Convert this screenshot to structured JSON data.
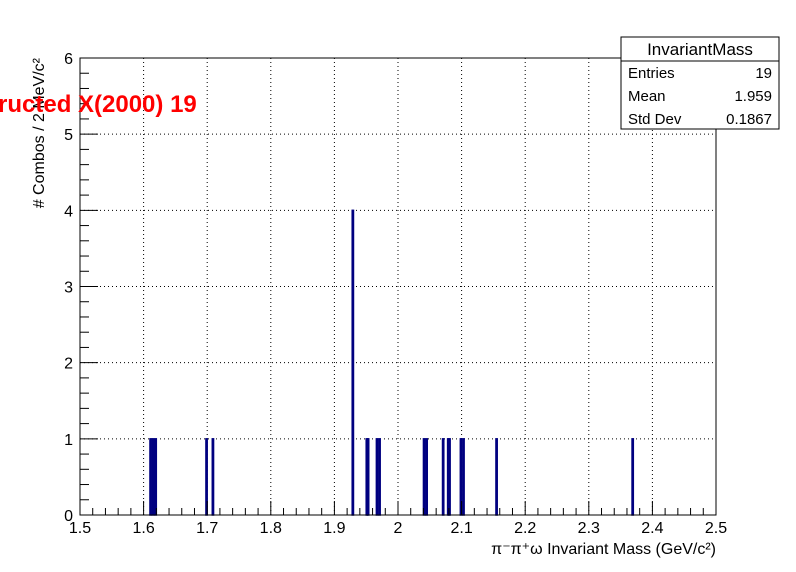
{
  "overlay_title": "ructed X(2000) 19",
  "stats_box": {
    "title": "InvariantMass",
    "rows": [
      {
        "label": "Entries",
        "value": "19"
      },
      {
        "label": "Mean",
        "value": "1.959"
      },
      {
        "label": "Std Dev",
        "value": "0.1867"
      }
    ]
  },
  "chart_data": {
    "type": "bar",
    "xlabel": "π⁻π⁺ω Invariant Mass (GeV/c²)",
    "ylabel": "# Combos / 2 MeV/c²",
    "xlim": [
      1.5,
      2.5
    ],
    "ylim": [
      0,
      6
    ],
    "grid": true,
    "bar_color": "#000080",
    "x_ticks": [
      "1.5",
      "1.6",
      "1.7",
      "1.8",
      "1.9",
      "2",
      "2.1",
      "2.2",
      "2.3",
      "2.4",
      "2.5"
    ],
    "y_ticks": [
      "0",
      "1",
      "2",
      "3",
      "4",
      "5",
      "6"
    ],
    "bins": [
      {
        "x": 1.611,
        "count": 1
      },
      {
        "x": 1.615,
        "count": 1
      },
      {
        "x": 1.619,
        "count": 1
      },
      {
        "x": 1.699,
        "count": 1
      },
      {
        "x": 1.709,
        "count": 1
      },
      {
        "x": 1.929,
        "count": 4
      },
      {
        "x": 1.951,
        "count": 1
      },
      {
        "x": 1.953,
        "count": 1
      },
      {
        "x": 1.967,
        "count": 1
      },
      {
        "x": 1.971,
        "count": 1
      },
      {
        "x": 2.041,
        "count": 1
      },
      {
        "x": 2.045,
        "count": 1
      },
      {
        "x": 2.071,
        "count": 1
      },
      {
        "x": 2.079,
        "count": 1
      },
      {
        "x": 2.081,
        "count": 1
      },
      {
        "x": 2.099,
        "count": 1
      },
      {
        "x": 2.103,
        "count": 1
      },
      {
        "x": 2.155,
        "count": 1
      },
      {
        "x": 2.369,
        "count": 1
      }
    ]
  }
}
